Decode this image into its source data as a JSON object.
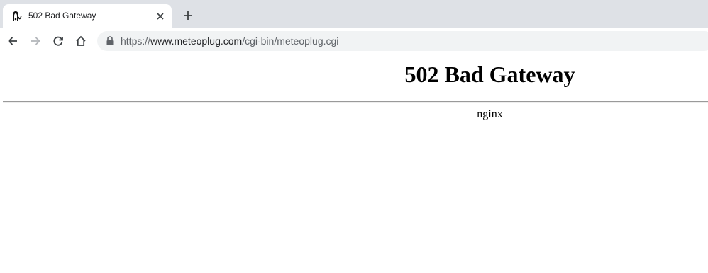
{
  "browser": {
    "tab": {
      "title": "502 Bad Gateway",
      "favicon": "meteoplug-icon"
    },
    "new_tab_icon": "plus-icon",
    "nav": {
      "back_icon": "arrow-left-icon",
      "forward_icon": "arrow-right-icon",
      "reload_icon": "reload-icon",
      "home_icon": "home-icon"
    },
    "address": {
      "scheme": "https://",
      "host": "www.meteoplug.com",
      "path": "/cgi-bin/meteoplug.cgi",
      "lock_icon": "lock-icon"
    }
  },
  "page": {
    "heading": "502 Bad Gateway",
    "server": "nginx"
  },
  "colors": {
    "tabstrip": "#dee1e6",
    "omnibox": "#f1f3f4",
    "url_dim": "#5f6368",
    "url_host": "#202124"
  }
}
